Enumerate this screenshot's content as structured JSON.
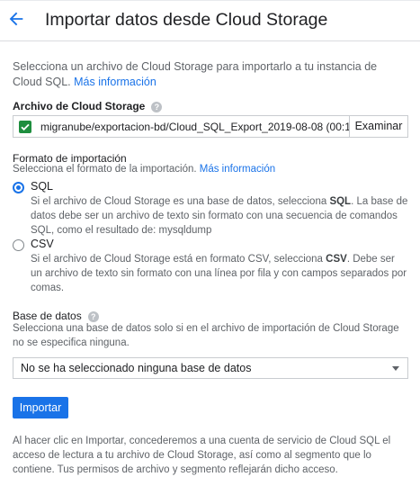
{
  "header": {
    "title": "Importar datos desde Cloud Storage",
    "back_icon": "arrow-back-icon"
  },
  "intro": {
    "text": "Selecciona un archivo de Cloud Storage para importarlo a tu instancia de Cloud SQL.",
    "link": "Más información"
  },
  "file_section": {
    "label": "Archivo de Cloud Storage",
    "value": "migranube/exportacion-bd/Cloud_SQL_Export_2019-08-08 (00:1",
    "browse_label": "Examinar"
  },
  "format_section": {
    "label": "Formato de importación",
    "subtitle": "Selecciona el formato de la importación.",
    "link": "Más información",
    "options": [
      {
        "label": "SQL",
        "desc_a": "Si el archivo de Cloud Storage es una base de datos, selecciona ",
        "desc_bold": "SQL",
        "desc_b": ". La base de datos debe ser un archivo de texto sin formato con una secuencia de comandos SQL, como el resultado de: mysqldump",
        "selected": true
      },
      {
        "label": "CSV",
        "desc_a": "Si el archivo de Cloud Storage está en formato CSV, selecciona ",
        "desc_bold": "CSV",
        "desc_b": ". Debe ser un archivo de texto sin formato con una línea por fila y con campos separados por comas.",
        "selected": false
      }
    ]
  },
  "database_section": {
    "label": "Base de datos",
    "description": "Selecciona una base de datos solo si en el archivo de importación de Cloud Storage no se especifica ninguna.",
    "selected": "No se ha seleccionado ninguna base de datos"
  },
  "import_button": "Importar",
  "footer": "Al hacer clic en Importar, concederemos a una cuenta de servicio de Cloud SQL el acceso de lectura a tu archivo de Cloud Storage, así como al segmento que lo contiene. Tus permisos de archivo y segmento reflejarán dicho acceso.",
  "help_icon_glyph": "?",
  "colors": {
    "accent": "#1a73e8",
    "success": "#1e8e3e",
    "text": "#202124",
    "secondary_text": "#5f6368"
  }
}
